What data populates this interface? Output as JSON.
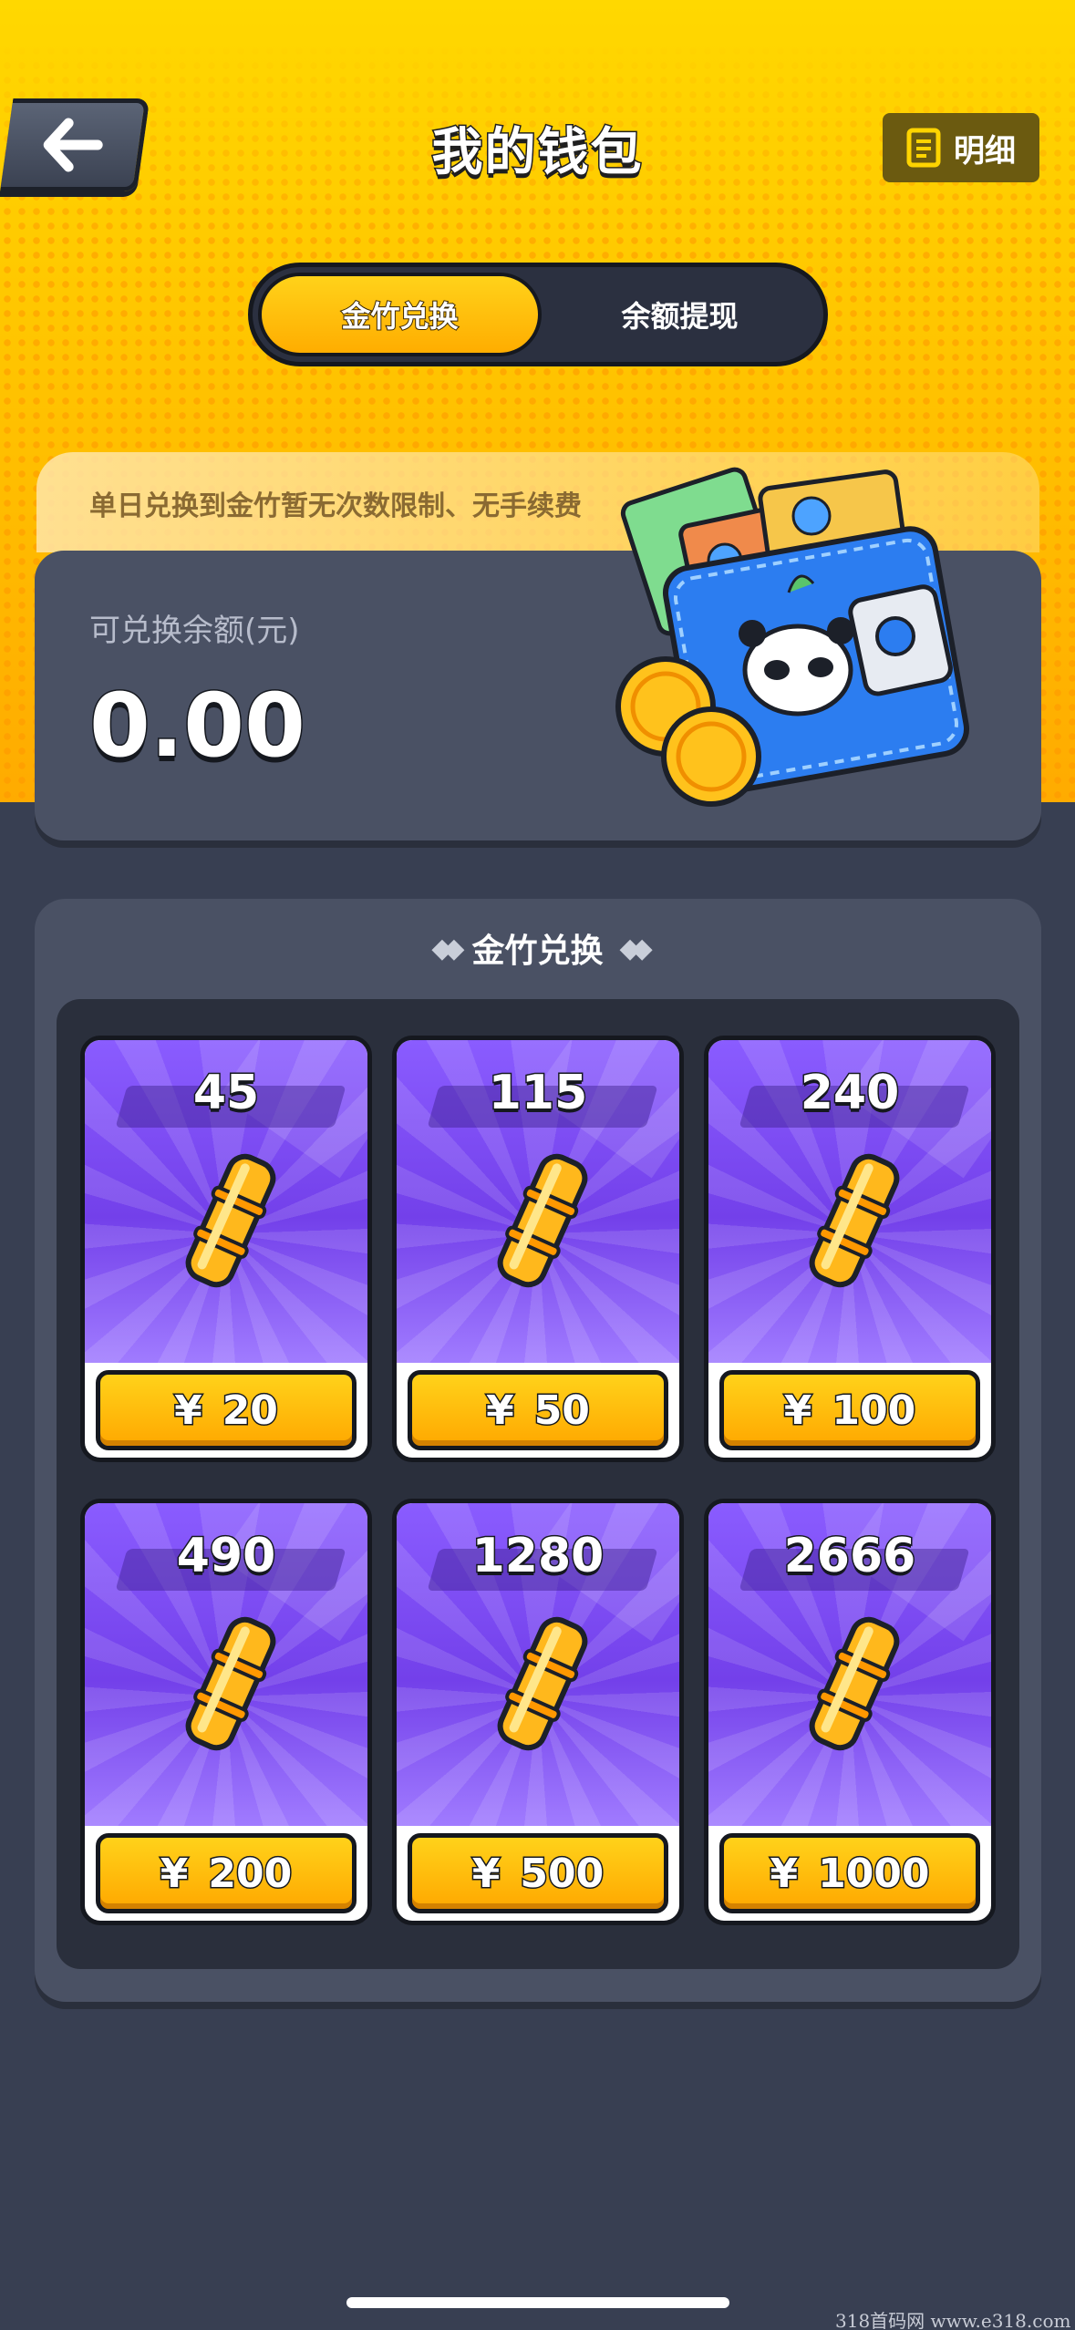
{
  "header": {
    "title": "我的钱包",
    "detail_label": "明细"
  },
  "tabs": [
    {
      "label": "金竹兑换",
      "active": true
    },
    {
      "label": "余额提现",
      "active": false
    }
  ],
  "balance": {
    "notice": "单日兑换到金竹暂无次数限制、无手续费",
    "label": "可兑换余额(元)",
    "value": "0.00"
  },
  "exchange": {
    "title": "金竹兑换",
    "currency_symbol": "¥",
    "items": [
      {
        "bamboo": "45",
        "price": "20"
      },
      {
        "bamboo": "115",
        "price": "50"
      },
      {
        "bamboo": "240",
        "price": "100"
      },
      {
        "bamboo": "490",
        "price": "200"
      },
      {
        "bamboo": "1280",
        "price": "500"
      },
      {
        "bamboo": "2666",
        "price": "1000"
      }
    ]
  },
  "watermark": "318首码网 www.e318.com",
  "colors": {
    "header_yellow": "#ffd800",
    "card_purple": "#7340ea",
    "button_gold": "#ffb800",
    "panel_bg": "#4a5164",
    "page_bg": "#383f52"
  }
}
